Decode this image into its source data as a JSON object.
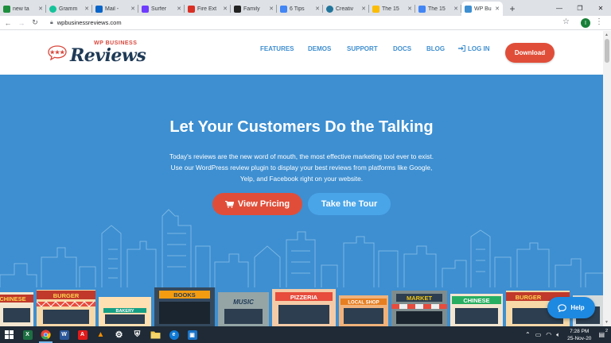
{
  "browser": {
    "tabs": [
      {
        "title": "new ta",
        "color": "#1e8e3e"
      },
      {
        "title": "Gramm",
        "color": "#15c39a"
      },
      {
        "title": "Mail - ",
        "color": "#0a64c8"
      },
      {
        "title": "Surfer",
        "color": "#6e3cff"
      },
      {
        "title": "Fire Ext",
        "color": "#d93025"
      },
      {
        "title": "Family",
        "color": "#222222"
      },
      {
        "title": "6 Tips",
        "color": "#4285f4"
      },
      {
        "title": "Creativ",
        "color": "#21759b"
      },
      {
        "title": "The 15",
        "color": "#fbbc04"
      },
      {
        "title": "The 15",
        "color": "#4285f4"
      }
    ],
    "active_tab": {
      "title": "WP Bu",
      "color": "#3d8fd1"
    },
    "new_tab": "+",
    "window_controls": {
      "minimize": "—",
      "restore": "❐",
      "close": "✕"
    },
    "url": "wpbusinessreviews.com",
    "profile_initial": "I"
  },
  "site": {
    "logo_small": "WP BUSINESS",
    "logo_big": "Reviews",
    "nav": {
      "features": "FEATURES",
      "demos": "DEMOS",
      "support": "SUPPORT",
      "docs": "DOCS",
      "blog": "BLOG",
      "login": "LOG IN"
    },
    "download": "Download"
  },
  "hero": {
    "title": "Let Your Customers Do the Talking",
    "text_line1": "Today's reviews are the new word of mouth, the most effective marketing tool ever to exist.",
    "text_line2": "Use our WordPress review plugin to display your best reviews from platforms like Google,",
    "text_line3": "Yelp, and Facebook right on your website.",
    "btn_pricing": "View Pricing",
    "btn_tour": "Take the Tour",
    "stores": [
      "CHINESE",
      "BURGER",
      "BAKERY",
      "BOOKS",
      "MUSIC",
      "PIZZERIA",
      "LOCAL SHOP",
      "MARKET",
      "CHINESE",
      "BURGER"
    ]
  },
  "help": {
    "label": "Help"
  },
  "taskbar": {
    "apps": [
      {
        "name": "windows-start",
        "label": "",
        "color": "#1f2a36"
      },
      {
        "name": "excel",
        "label": "X",
        "color": "#1d6f42"
      },
      {
        "name": "chrome",
        "label": "",
        "color": "#ea4335"
      },
      {
        "name": "word",
        "label": "W",
        "color": "#2b579a"
      },
      {
        "name": "acrobat",
        "label": "A",
        "color": "#e21a1a"
      },
      {
        "name": "vlc",
        "label": "▲",
        "color": "#f08c00"
      },
      {
        "name": "settings",
        "label": "⚙",
        "color": "#444444"
      },
      {
        "name": "security",
        "label": "⛨",
        "color": "#555555"
      },
      {
        "name": "folder",
        "label": "",
        "color": "#f2c94c"
      },
      {
        "name": "edge",
        "label": "e",
        "color": "#0f7ad6"
      },
      {
        "name": "photos",
        "label": "▣",
        "color": "#1a73c7"
      }
    ],
    "time": "7:28 PM",
    "date": "25-Nov-20",
    "notification_count": "2"
  }
}
